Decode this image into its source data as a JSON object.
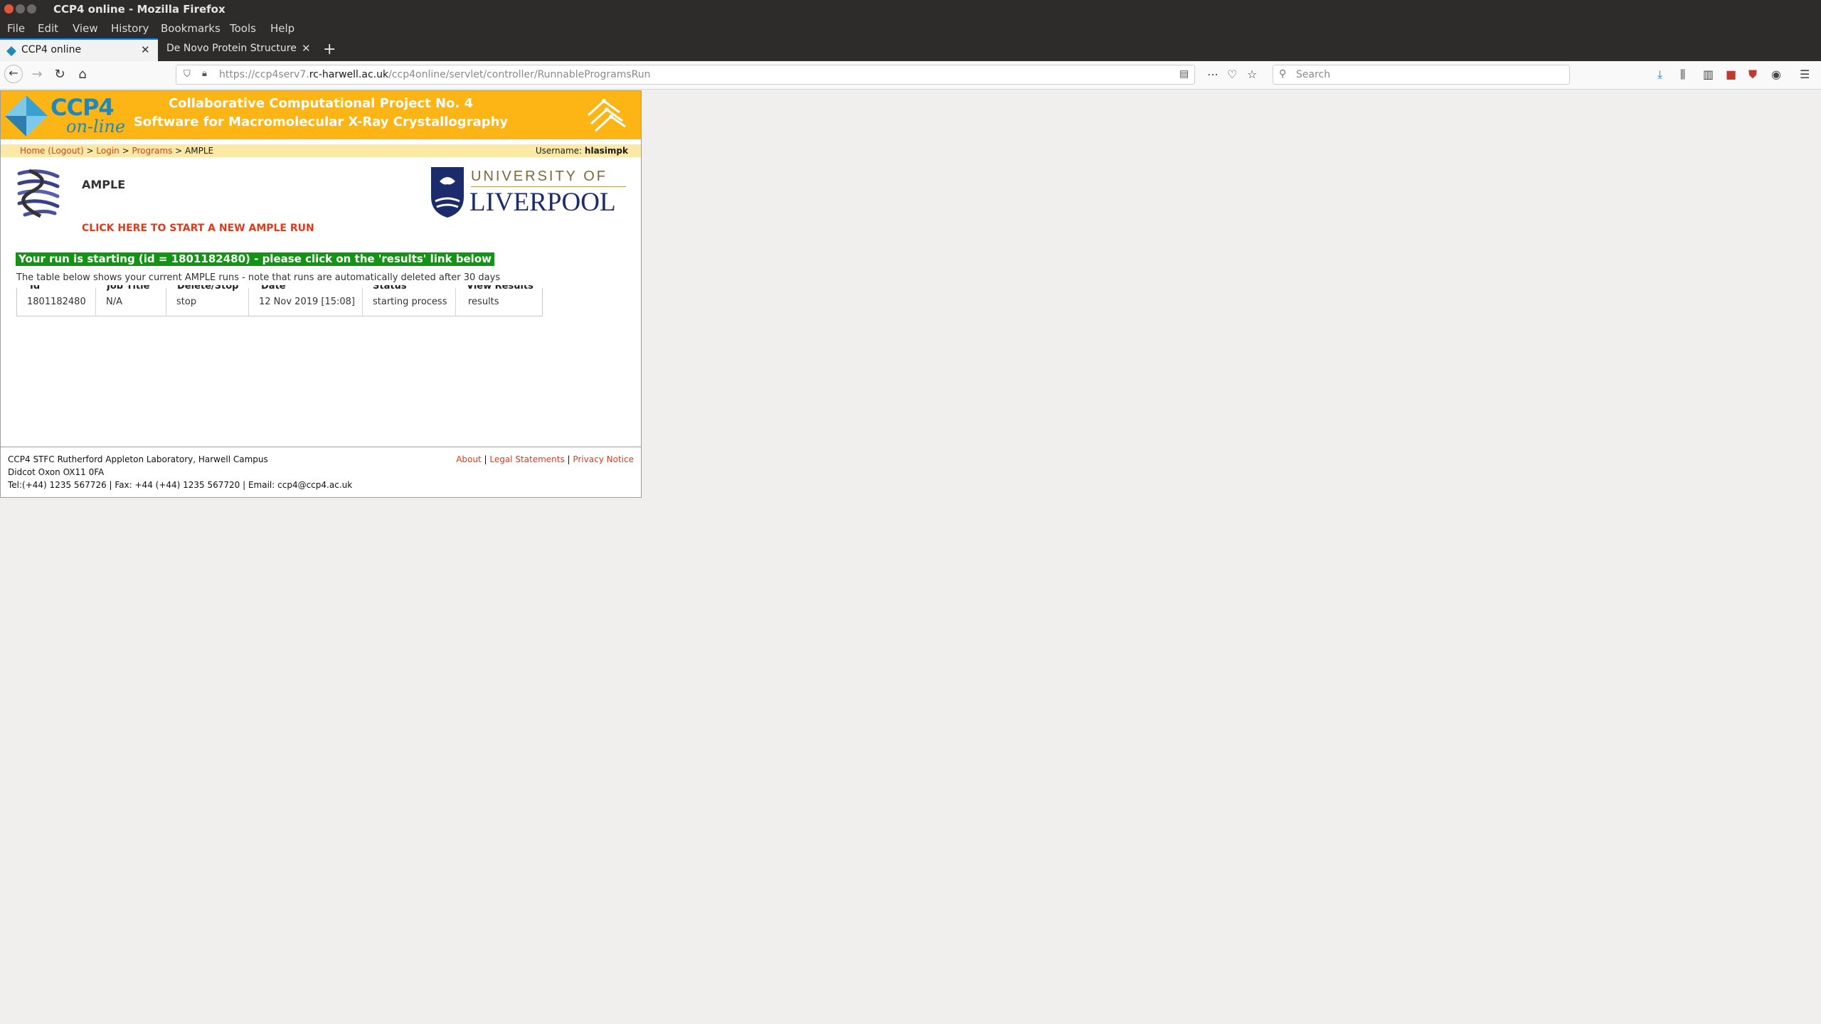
{
  "window": {
    "title": "CCP4 online - Mozilla Firefox"
  },
  "menu": [
    "File",
    "Edit",
    "View",
    "History",
    "Bookmarks",
    "Tools",
    "Help"
  ],
  "tabs": [
    {
      "title": "CCP4 online",
      "active": true
    },
    {
      "title": "De Novo Protein Structure",
      "active": false
    }
  ],
  "nav": {
    "url_prefix": "https://ccp4serv7.",
    "url_host": "rc-harwell.ac.uk",
    "url_path": "/ccp4online/servlet/controller/RunnableProgramsRun",
    "search_placeholder": "Search"
  },
  "banner": {
    "logo_main": "CCP4",
    "logo_sub": "on-line",
    "title_line1": "Collaborative Computational Project No. 4",
    "title_line2": "Software for Macromolecular X-Ray Crystallography"
  },
  "breadcrumb": {
    "home": "Home (Logout)",
    "sep": " > ",
    "login": "Login",
    "programs": "Programs",
    "current": "AMPLE",
    "username_label": "Username:",
    "username": "hlasimpk"
  },
  "program": {
    "name": "AMPLE",
    "new_run_link": "CLICK HERE TO START A NEW AMPLE RUN",
    "university_top": "UNIVERSITY OF",
    "university_main": "LIVERPOOL"
  },
  "notice": "Your run is starting (id = 1801182480) - please click on the 'results' link below",
  "table_note": "The table below shows your current AMPLE runs - note that runs are automatically deleted after 30 days",
  "table": {
    "headers": [
      "Id",
      "Job Title",
      "Delete/Stop",
      "Date",
      "Status",
      "View Results"
    ],
    "rows": [
      [
        "1801182480",
        "N/A",
        "stop",
        "12 Nov 2019 [15:08]",
        "starting process",
        "results"
      ]
    ]
  },
  "footer": {
    "line1": "CCP4 STFC Rutherford Appleton Laboratory, Harwell Campus",
    "line2": "Didcot Oxon OX11 0FA",
    "line3": "Tel:(+44) 1235 567726 | Fax: +44 (+44) 1235 567720 | Email: ccp4@ccp4.ac.uk",
    "links": [
      "About",
      "Legal Statements",
      "Privacy Notice"
    ],
    "link_sep": " | "
  }
}
